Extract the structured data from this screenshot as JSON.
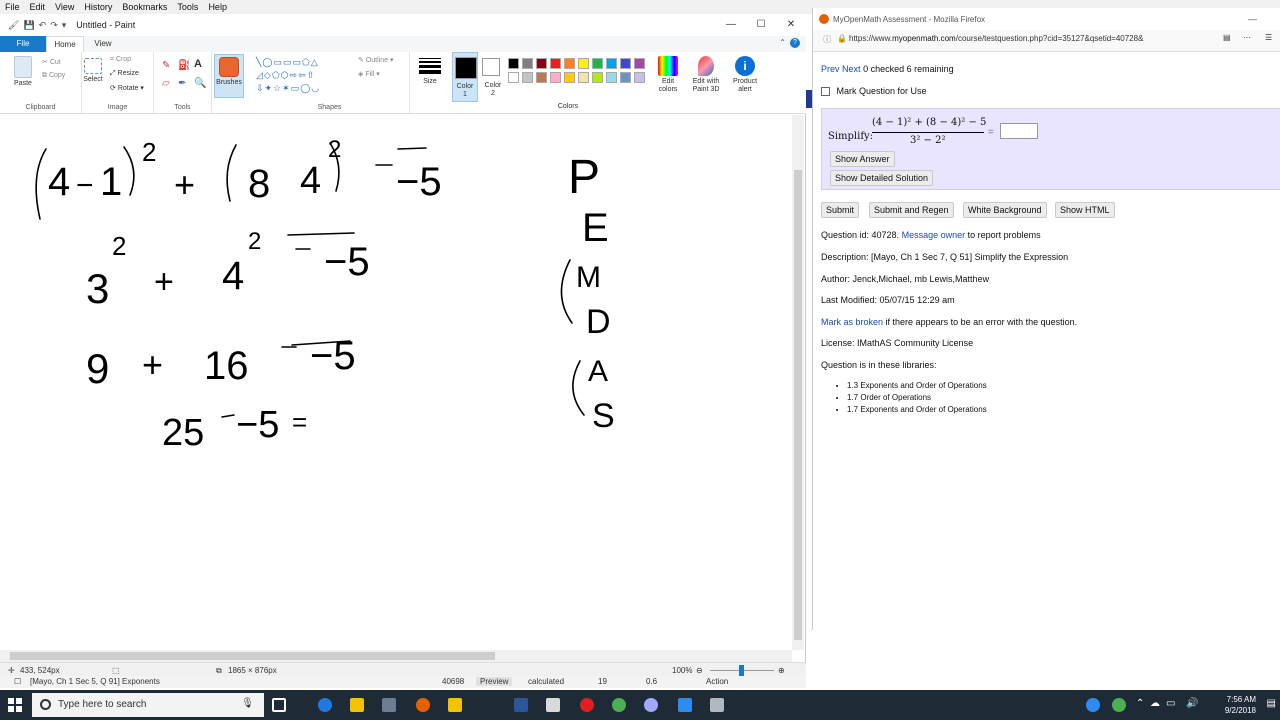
{
  "topmenu": {
    "items": [
      "File",
      "Edit",
      "View",
      "History",
      "Bookmarks",
      "Tools",
      "Help"
    ]
  },
  "paint": {
    "title": "Untitled - Paint",
    "tabs": {
      "file": "File",
      "home": "Home",
      "view": "View"
    },
    "groups": {
      "clipboard": "Clipboard",
      "image": "Image",
      "tools": "Tools",
      "shapes": "Shapes",
      "colors": "Colors"
    },
    "buttons": {
      "paste": "Paste",
      "cut": "Cut",
      "copy": "Copy",
      "select": "Select",
      "crop": "Crop",
      "resize": "Resize",
      "rotate": "Rotate",
      "brushes": "Brushes",
      "outline": "Outline",
      "fill": "Fill",
      "size": "Size",
      "color1": "Color",
      "color1_num": "1",
      "color2": "Color",
      "color2_num": "2",
      "edit_colors": "Edit colors",
      "edit_3d": "Edit with Paint 3D",
      "product_alert": "Product alert"
    },
    "palette_row1": [
      "#000000",
      "#7f7f7f",
      "#880015",
      "#ed1c24",
      "#ff7f27",
      "#fff200",
      "#22b14c",
      "#00a2e8",
      "#3f48cc",
      "#a349a4"
    ],
    "palette_row2": [
      "#ffffff",
      "#c3c3c3",
      "#b97a57",
      "#ffaec9",
      "#ffc90e",
      "#efe4b0",
      "#b5e61d",
      "#99d9ea",
      "#7092be",
      "#c8bfe7"
    ],
    "status": {
      "cursor": "433, 524px",
      "size": "1865 × 876px",
      "zoom": "100%"
    }
  },
  "handwriting": {
    "line1": {
      "open": "(",
      "a": "4",
      "minus": "−",
      "b": "1",
      "close": ")",
      "exp": "2",
      "plus": "+",
      "c": "8",
      "d": "4",
      "exp2": "2",
      "tail": "−5"
    },
    "line2": {
      "a": "3",
      "exp": "2",
      "plus": "+",
      "b": "4",
      "exp2": "2",
      "tail": "−5"
    },
    "line3": {
      "a": "9",
      "plus": "+",
      "b": "16",
      "tail": "−5"
    },
    "line4": {
      "a": "25",
      "minus": "−5",
      "eq": "="
    },
    "pemdas": [
      "P",
      "E",
      "M",
      "D",
      "A",
      "S"
    ]
  },
  "firefox": {
    "title": "MyOpenMath Assessment - Mozilla Firefox",
    "url_prefix": "https://www.",
    "url_domain": "myopenmath.com",
    "url_rest": "/course/testquestion.php?cid=35127&qsetid=40728&",
    "nav": {
      "prev": "Prev",
      "next": "Next",
      "status": "0 checked 6 remaining"
    },
    "mark_question": "Mark Question for Use",
    "simplify_label": "Simplify:",
    "numerator": "(4 − 1)² + (8 − 4)² − 5",
    "denominator": "3² − 2²",
    "equals": "=",
    "show_answer": "Show Answer",
    "show_solution": "Show Detailed Solution",
    "actions": [
      "Submit",
      "Submit and Regen",
      "White Background",
      "Show HTML"
    ],
    "question_id": "Question id: 40728.",
    "message_owner": "Message owner",
    "report_tail": "to report problems",
    "description": "Description: [Mayo, Ch 1 Sec 7, Q 51] Simplify the Expression",
    "author": "Author: Jenck,Michael, mb Lewis,Matthew",
    "modified": "Last Modified: 05/07/15 12:29 am",
    "mark_broken": "Mark as broken",
    "broken_tail": "if there appears to be an error with the question.",
    "license": "License: IMathAS Community License",
    "libraries_label": "Question is in these libraries:",
    "libraries": [
      "1.3 Exponents and Order of Operations",
      "1.7 Order of Operations",
      "1.7 Exponents and Order of Operations"
    ]
  },
  "behind": {
    "left": "[Mayo, Ch 1 Sec 5, Q 91] Exponents",
    "id": "40698",
    "preview": "Preview",
    "calculated": "calculated",
    "n1": "19",
    "n2": "0.6",
    "action": "Action"
  },
  "taskbar": {
    "search_placeholder": "Type here to search",
    "time": "7:56 AM",
    "date": "9/2/2018"
  }
}
